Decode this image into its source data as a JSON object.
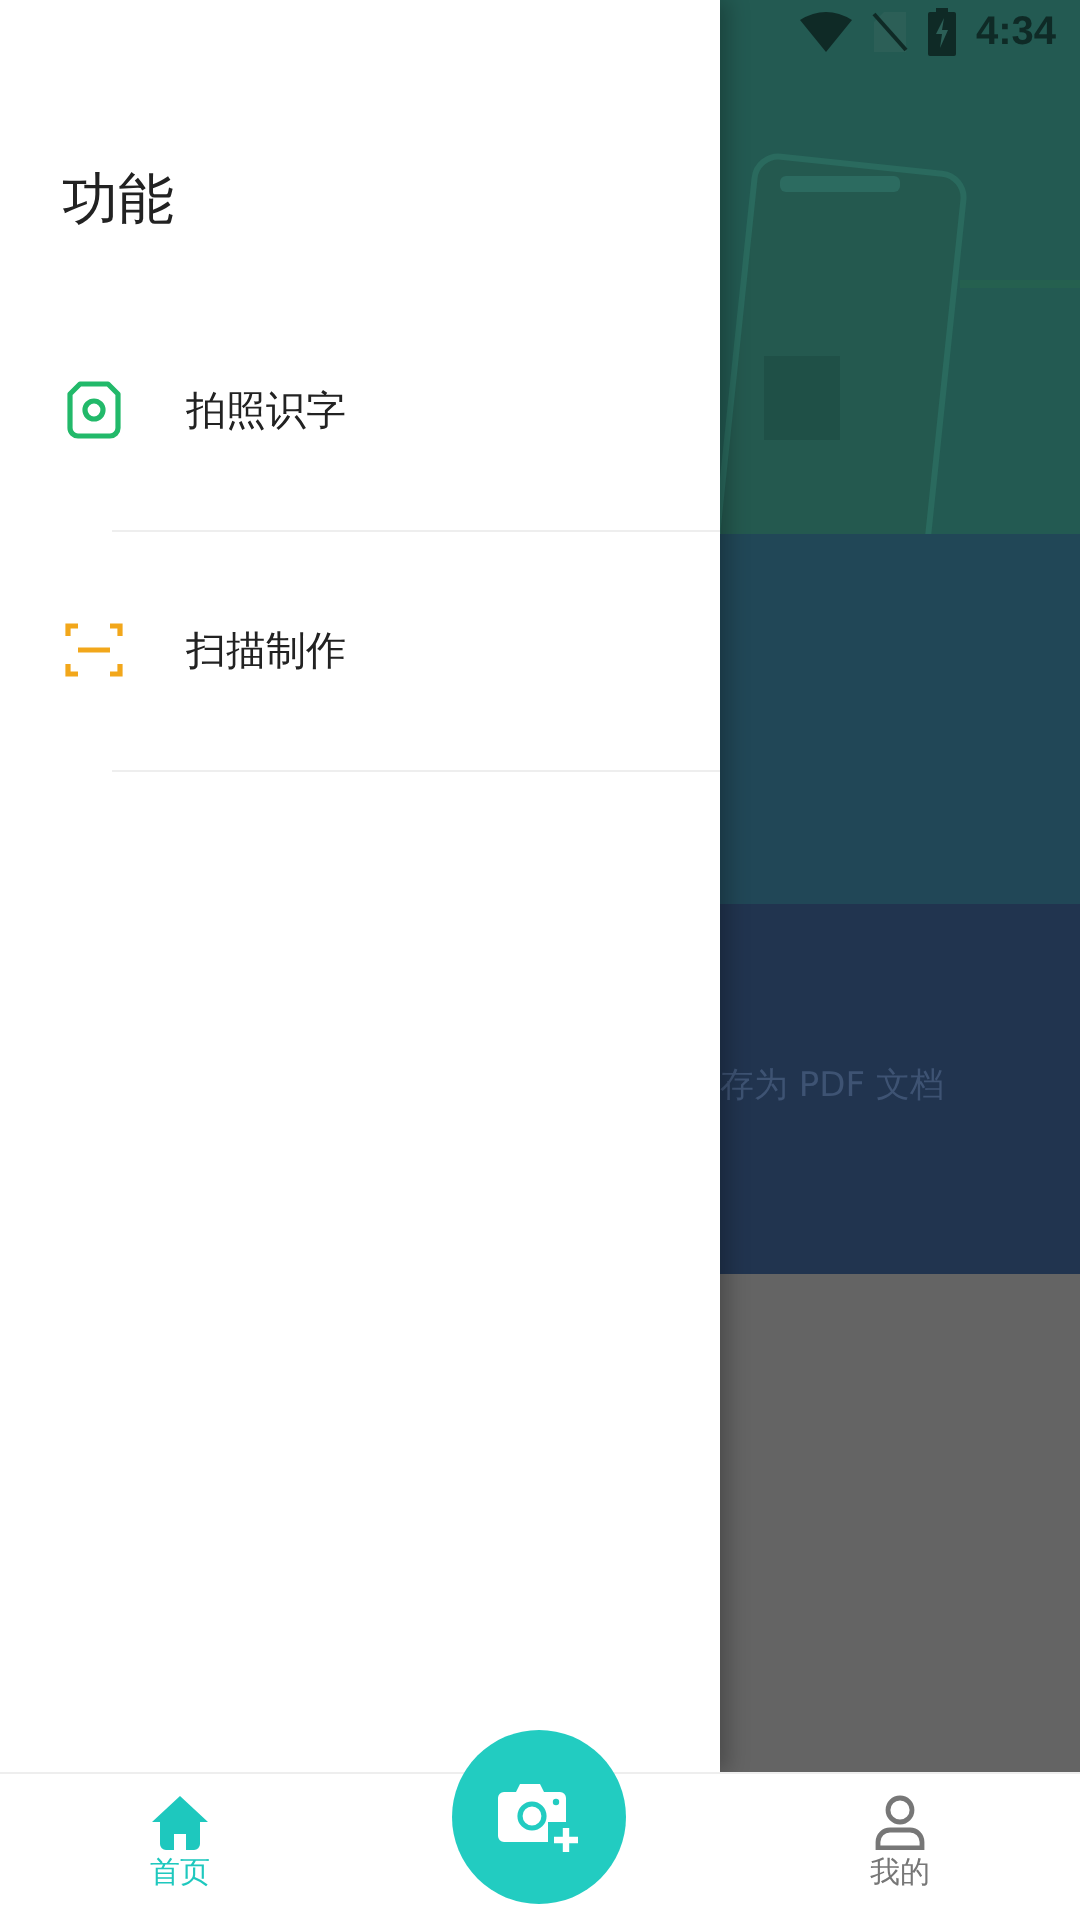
{
  "drawer": {
    "title": "功能",
    "items": [
      {
        "label": "拍照识字",
        "kind": "camera"
      },
      {
        "label": "扫描制作",
        "kind": "scan"
      }
    ]
  },
  "background": {
    "status_bar": {
      "time": "4:34"
    },
    "banner_text": "存为 PDF 文档"
  },
  "bottom_nav": {
    "items": [
      {
        "label": "首页",
        "kind": "home",
        "selected": true
      },
      {
        "label": "我的",
        "kind": "profile",
        "selected": false
      }
    ]
  }
}
